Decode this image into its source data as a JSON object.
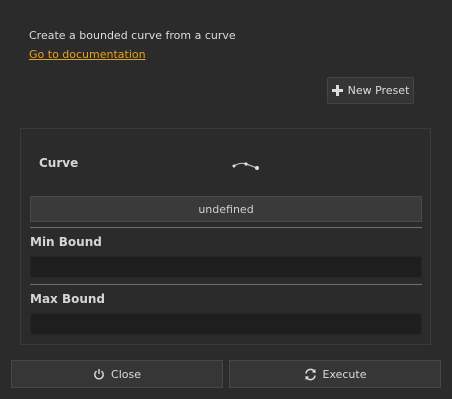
{
  "header": {
    "description": "Create a bounded curve from a curve",
    "doc_link": "Go to documentation"
  },
  "preset": {
    "label": "New Preset",
    "icon": "plus-icon"
  },
  "curve": {
    "label": "Curve",
    "icon": "curve-select-icon",
    "value": "undefined"
  },
  "min_bound": {
    "label": "Min Bound",
    "value": ""
  },
  "max_bound": {
    "label": "Max Bound",
    "value": ""
  },
  "footer": {
    "close_label": "Close",
    "close_icon": "power-icon",
    "execute_label": "Execute",
    "execute_icon": "refresh-icon"
  },
  "colors": {
    "background": "#2b2b2b",
    "link": "#e8a31c",
    "input_bg": "#1e1e1e"
  }
}
